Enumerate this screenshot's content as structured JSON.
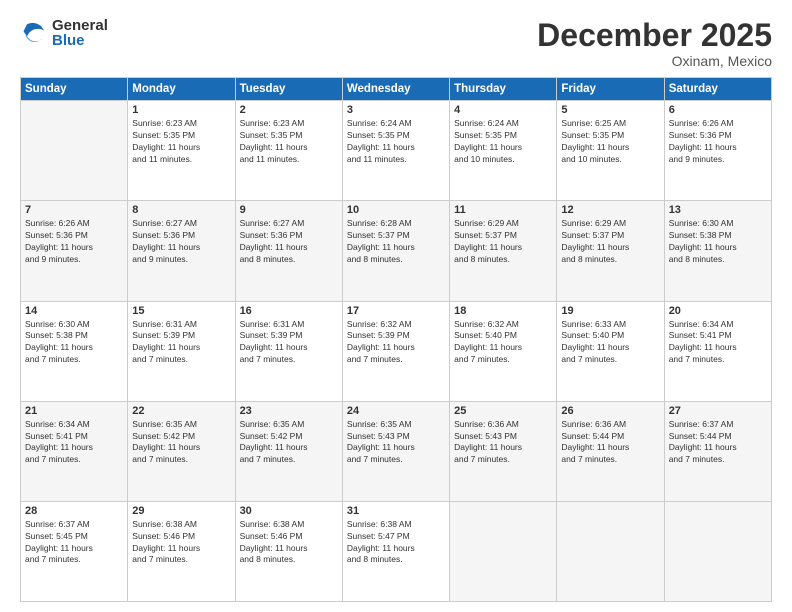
{
  "header": {
    "logo": {
      "general": "General",
      "blue": "Blue"
    },
    "title": "December 2025",
    "location": "Oxinam, Mexico"
  },
  "days_of_week": [
    "Sunday",
    "Monday",
    "Tuesday",
    "Wednesday",
    "Thursday",
    "Friday",
    "Saturday"
  ],
  "weeks": [
    [
      {
        "day": "",
        "info": ""
      },
      {
        "day": "1",
        "info": "Sunrise: 6:23 AM\nSunset: 5:35 PM\nDaylight: 11 hours\nand 11 minutes."
      },
      {
        "day": "2",
        "info": "Sunrise: 6:23 AM\nSunset: 5:35 PM\nDaylight: 11 hours\nand 11 minutes."
      },
      {
        "day": "3",
        "info": "Sunrise: 6:24 AM\nSunset: 5:35 PM\nDaylight: 11 hours\nand 11 minutes."
      },
      {
        "day": "4",
        "info": "Sunrise: 6:24 AM\nSunset: 5:35 PM\nDaylight: 11 hours\nand 10 minutes."
      },
      {
        "day": "5",
        "info": "Sunrise: 6:25 AM\nSunset: 5:35 PM\nDaylight: 11 hours\nand 10 minutes."
      },
      {
        "day": "6",
        "info": "Sunrise: 6:26 AM\nSunset: 5:36 PM\nDaylight: 11 hours\nand 9 minutes."
      }
    ],
    [
      {
        "day": "7",
        "info": "Sunrise: 6:26 AM\nSunset: 5:36 PM\nDaylight: 11 hours\nand 9 minutes."
      },
      {
        "day": "8",
        "info": "Sunrise: 6:27 AM\nSunset: 5:36 PM\nDaylight: 11 hours\nand 9 minutes."
      },
      {
        "day": "9",
        "info": "Sunrise: 6:27 AM\nSunset: 5:36 PM\nDaylight: 11 hours\nand 8 minutes."
      },
      {
        "day": "10",
        "info": "Sunrise: 6:28 AM\nSunset: 5:37 PM\nDaylight: 11 hours\nand 8 minutes."
      },
      {
        "day": "11",
        "info": "Sunrise: 6:29 AM\nSunset: 5:37 PM\nDaylight: 11 hours\nand 8 minutes."
      },
      {
        "day": "12",
        "info": "Sunrise: 6:29 AM\nSunset: 5:37 PM\nDaylight: 11 hours\nand 8 minutes."
      },
      {
        "day": "13",
        "info": "Sunrise: 6:30 AM\nSunset: 5:38 PM\nDaylight: 11 hours\nand 8 minutes."
      }
    ],
    [
      {
        "day": "14",
        "info": "Sunrise: 6:30 AM\nSunset: 5:38 PM\nDaylight: 11 hours\nand 7 minutes."
      },
      {
        "day": "15",
        "info": "Sunrise: 6:31 AM\nSunset: 5:39 PM\nDaylight: 11 hours\nand 7 minutes."
      },
      {
        "day": "16",
        "info": "Sunrise: 6:31 AM\nSunset: 5:39 PM\nDaylight: 11 hours\nand 7 minutes."
      },
      {
        "day": "17",
        "info": "Sunrise: 6:32 AM\nSunset: 5:39 PM\nDaylight: 11 hours\nand 7 minutes."
      },
      {
        "day": "18",
        "info": "Sunrise: 6:32 AM\nSunset: 5:40 PM\nDaylight: 11 hours\nand 7 minutes."
      },
      {
        "day": "19",
        "info": "Sunrise: 6:33 AM\nSunset: 5:40 PM\nDaylight: 11 hours\nand 7 minutes."
      },
      {
        "day": "20",
        "info": "Sunrise: 6:34 AM\nSunset: 5:41 PM\nDaylight: 11 hours\nand 7 minutes."
      }
    ],
    [
      {
        "day": "21",
        "info": "Sunrise: 6:34 AM\nSunset: 5:41 PM\nDaylight: 11 hours\nand 7 minutes."
      },
      {
        "day": "22",
        "info": "Sunrise: 6:35 AM\nSunset: 5:42 PM\nDaylight: 11 hours\nand 7 minutes."
      },
      {
        "day": "23",
        "info": "Sunrise: 6:35 AM\nSunset: 5:42 PM\nDaylight: 11 hours\nand 7 minutes."
      },
      {
        "day": "24",
        "info": "Sunrise: 6:35 AM\nSunset: 5:43 PM\nDaylight: 11 hours\nand 7 minutes."
      },
      {
        "day": "25",
        "info": "Sunrise: 6:36 AM\nSunset: 5:43 PM\nDaylight: 11 hours\nand 7 minutes."
      },
      {
        "day": "26",
        "info": "Sunrise: 6:36 AM\nSunset: 5:44 PM\nDaylight: 11 hours\nand 7 minutes."
      },
      {
        "day": "27",
        "info": "Sunrise: 6:37 AM\nSunset: 5:44 PM\nDaylight: 11 hours\nand 7 minutes."
      }
    ],
    [
      {
        "day": "28",
        "info": "Sunrise: 6:37 AM\nSunset: 5:45 PM\nDaylight: 11 hours\nand 7 minutes."
      },
      {
        "day": "29",
        "info": "Sunrise: 6:38 AM\nSunset: 5:46 PM\nDaylight: 11 hours\nand 7 minutes."
      },
      {
        "day": "30",
        "info": "Sunrise: 6:38 AM\nSunset: 5:46 PM\nDaylight: 11 hours\nand 8 minutes."
      },
      {
        "day": "31",
        "info": "Sunrise: 6:38 AM\nSunset: 5:47 PM\nDaylight: 11 hours\nand 8 minutes."
      },
      {
        "day": "",
        "info": ""
      },
      {
        "day": "",
        "info": ""
      },
      {
        "day": "",
        "info": ""
      }
    ]
  ]
}
